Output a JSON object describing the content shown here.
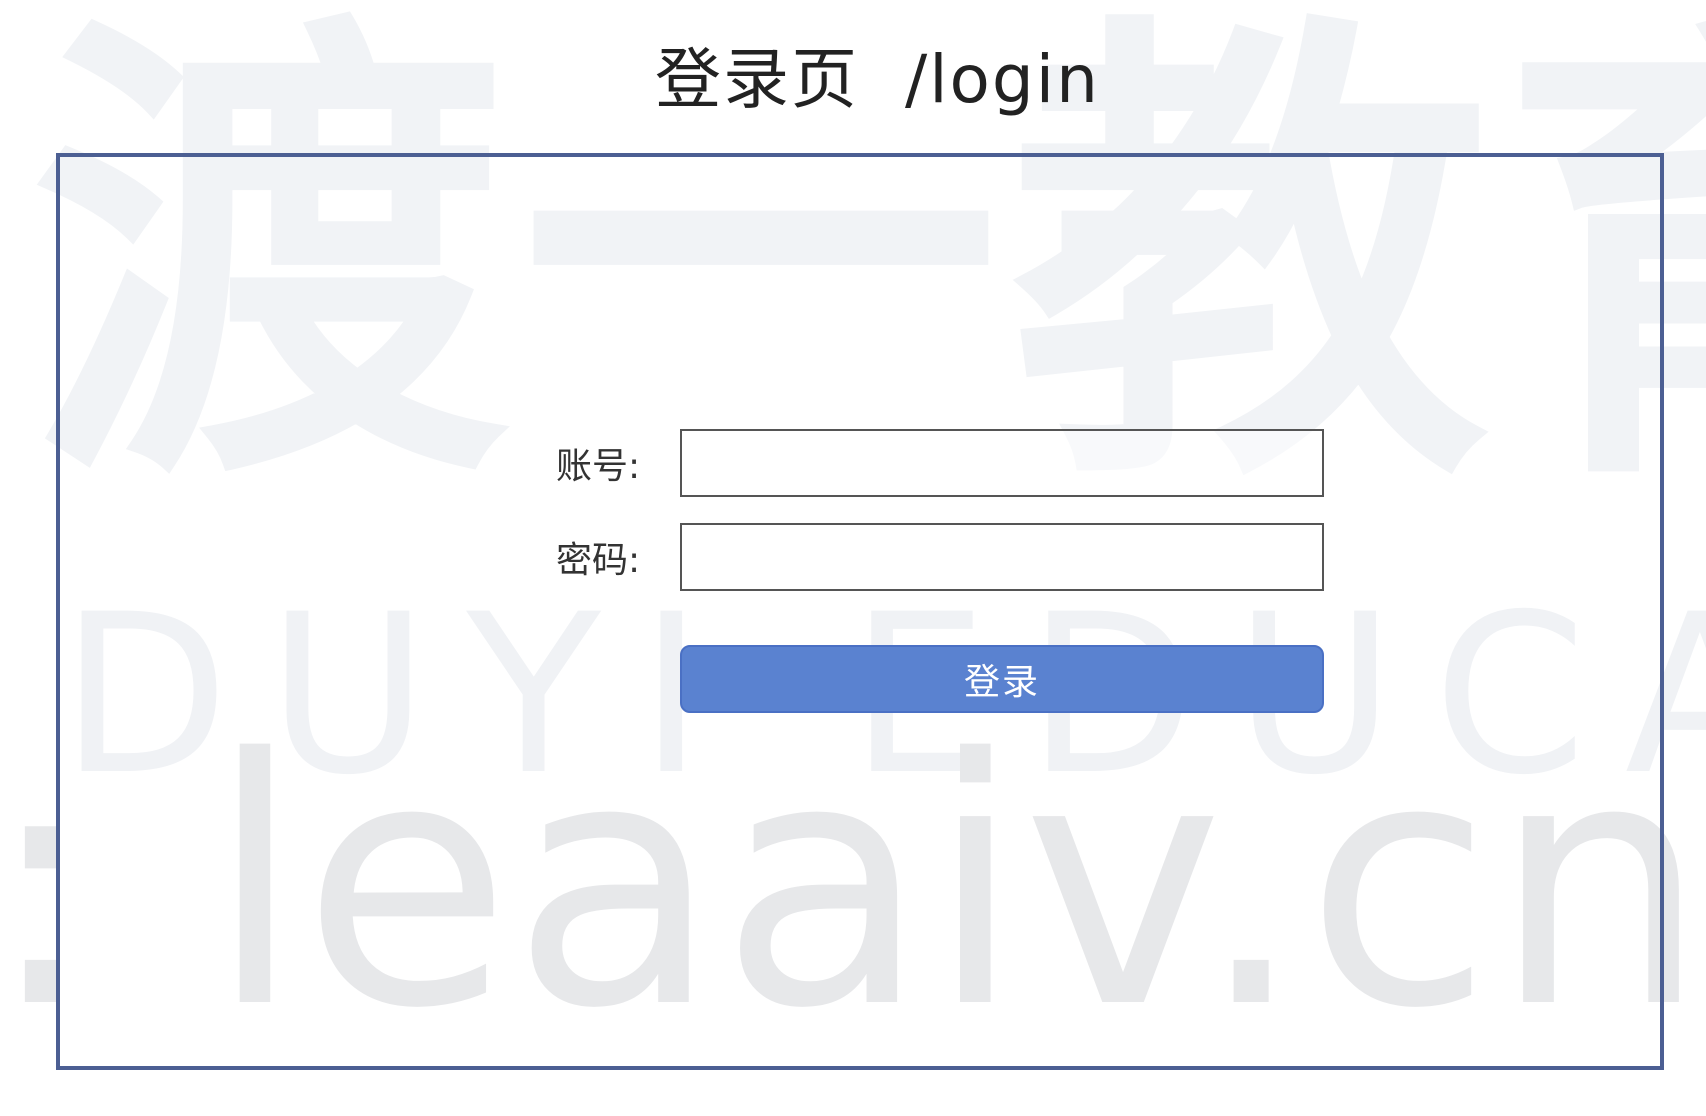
{
  "page": {
    "title": "登录页  /login"
  },
  "watermark": {
    "chinese": "渡一教育",
    "english": "DUYI EDUCATION",
    "url": ": leaaiv.cn"
  },
  "form": {
    "username_label": "账号:",
    "username_value": "",
    "password_label": "密码:",
    "password_value": "",
    "submit_label": "登录"
  }
}
